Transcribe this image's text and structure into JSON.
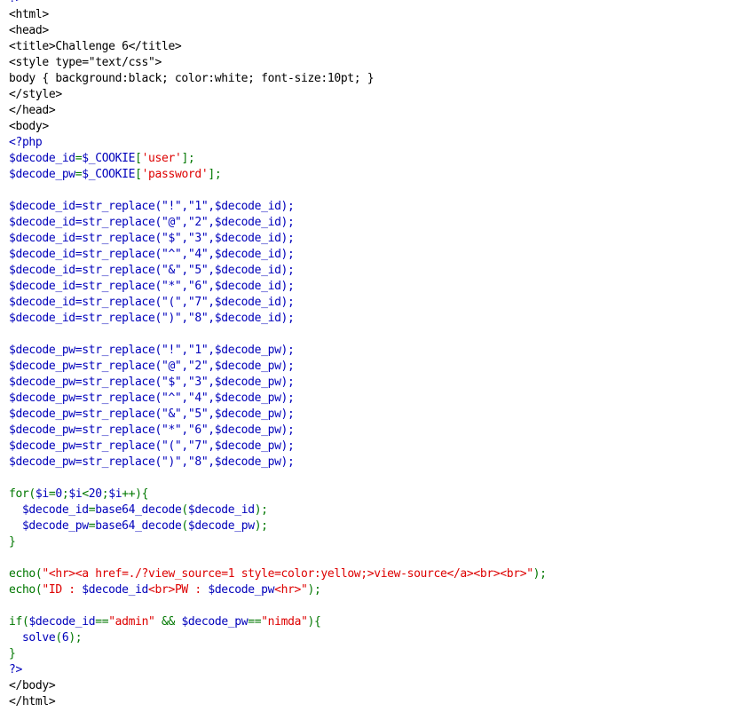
{
  "colors": {
    "html": "#000000",
    "php_default": "#0000BB",
    "php_keyword": "#007700",
    "php_string": "#DD0000",
    "background": "#FFFFFF"
  },
  "source_lines": [
    [
      {
        "t": "?>",
        "c": "php"
      }
    ],
    [
      {
        "t": "<html>",
        "c": "html"
      }
    ],
    [
      {
        "t": "<head>",
        "c": "html"
      }
    ],
    [
      {
        "t": "<title>Challenge 6</title>",
        "c": "html"
      }
    ],
    [
      {
        "t": "<style type=\"text/css\">",
        "c": "html"
      }
    ],
    [
      {
        "t": "body { background:black; color:white; font-size:10pt; }",
        "c": "html"
      }
    ],
    [
      {
        "t": "</style>",
        "c": "html"
      }
    ],
    [
      {
        "t": "</head>",
        "c": "html"
      }
    ],
    [
      {
        "t": "<body>",
        "c": "html"
      }
    ],
    [
      {
        "t": "<?php",
        "c": "php"
      }
    ],
    [
      {
        "t": "$decode_id",
        "c": "php"
      },
      {
        "t": "=",
        "c": "kw"
      },
      {
        "t": "$_COOKIE",
        "c": "php"
      },
      {
        "t": "[",
        "c": "kw"
      },
      {
        "t": "'user'",
        "c": "str"
      },
      {
        "t": "];",
        "c": "kw"
      }
    ],
    [
      {
        "t": "$decode_pw",
        "c": "php"
      },
      {
        "t": "=",
        "c": "kw"
      },
      {
        "t": "$_COOKIE",
        "c": "php"
      },
      {
        "t": "[",
        "c": "kw"
      },
      {
        "t": "'password'",
        "c": "str"
      },
      {
        "t": "];",
        "c": "kw"
      }
    ],
    [
      {
        "t": "",
        "c": "html"
      }
    ],
    [
      {
        "t": "$decode_id=str_replace(\"!\",\"1\",$decode_id);",
        "c": "php"
      }
    ],
    [
      {
        "t": "$decode_id=str_replace(\"@\",\"2\",$decode_id);",
        "c": "php"
      }
    ],
    [
      {
        "t": "$decode_id=str_replace(\"$\",\"3\",$decode_id);",
        "c": "php"
      }
    ],
    [
      {
        "t": "$decode_id=str_replace(\"^\",\"4\",$decode_id);",
        "c": "php"
      }
    ],
    [
      {
        "t": "$decode_id=str_replace(\"&\",\"5\",$decode_id);",
        "c": "php"
      }
    ],
    [
      {
        "t": "$decode_id=str_replace(\"*\",\"6\",$decode_id);",
        "c": "php"
      }
    ],
    [
      {
        "t": "$decode_id=str_replace(\"(\",\"7\",$decode_id);",
        "c": "php"
      }
    ],
    [
      {
        "t": "$decode_id=str_replace(\")\",\"8\",$decode_id);",
        "c": "php"
      }
    ],
    [
      {
        "t": "",
        "c": "html"
      }
    ],
    [
      {
        "t": "$decode_pw=str_replace(\"!\",\"1\",$decode_pw);",
        "c": "php"
      }
    ],
    [
      {
        "t": "$decode_pw=str_replace(\"@\",\"2\",$decode_pw);",
        "c": "php"
      }
    ],
    [
      {
        "t": "$decode_pw=str_replace(\"$\",\"3\",$decode_pw);",
        "c": "php"
      }
    ],
    [
      {
        "t": "$decode_pw=str_replace(\"^\",\"4\",$decode_pw);",
        "c": "php"
      }
    ],
    [
      {
        "t": "$decode_pw=str_replace(\"&\",\"5\",$decode_pw);",
        "c": "php"
      }
    ],
    [
      {
        "t": "$decode_pw=str_replace(\"*\",\"6\",$decode_pw);",
        "c": "php"
      }
    ],
    [
      {
        "t": "$decode_pw=str_replace(\"(\",\"7\",$decode_pw);",
        "c": "php"
      }
    ],
    [
      {
        "t": "$decode_pw=str_replace(\")\",\"8\",$decode_pw);",
        "c": "php"
      }
    ],
    [
      {
        "t": "",
        "c": "html"
      }
    ],
    [
      {
        "t": "for(",
        "c": "kw"
      },
      {
        "t": "$i",
        "c": "php"
      },
      {
        "t": "=",
        "c": "kw"
      },
      {
        "t": "0",
        "c": "php"
      },
      {
        "t": ";",
        "c": "kw"
      },
      {
        "t": "$i",
        "c": "php"
      },
      {
        "t": "<",
        "c": "kw"
      },
      {
        "t": "20",
        "c": "php"
      },
      {
        "t": ";",
        "c": "kw"
      },
      {
        "t": "$i",
        "c": "php"
      },
      {
        "t": "++){",
        "c": "kw"
      }
    ],
    [
      {
        "t": "  $decode_id",
        "c": "php"
      },
      {
        "t": "=",
        "c": "kw"
      },
      {
        "t": "base64_decode",
        "c": "php"
      },
      {
        "t": "(",
        "c": "kw"
      },
      {
        "t": "$decode_id",
        "c": "php"
      },
      {
        "t": ");",
        "c": "kw"
      }
    ],
    [
      {
        "t": "  $decode_pw",
        "c": "php"
      },
      {
        "t": "=",
        "c": "kw"
      },
      {
        "t": "base64_decode",
        "c": "php"
      },
      {
        "t": "(",
        "c": "kw"
      },
      {
        "t": "$decode_pw",
        "c": "php"
      },
      {
        "t": ");",
        "c": "kw"
      }
    ],
    [
      {
        "t": "}",
        "c": "kw"
      }
    ],
    [
      {
        "t": "",
        "c": "html"
      }
    ],
    [
      {
        "t": "echo(",
        "c": "kw"
      },
      {
        "t": "\"<hr><a href=./?view_source=1 style=color:yellow;>view-source</a><br><br>\"",
        "c": "str"
      },
      {
        "t": ");",
        "c": "kw"
      }
    ],
    [
      {
        "t": "echo(",
        "c": "kw"
      },
      {
        "t": "\"ID : ",
        "c": "str"
      },
      {
        "t": "$decode_id",
        "c": "php"
      },
      {
        "t": "<br>PW : ",
        "c": "str"
      },
      {
        "t": "$decode_pw",
        "c": "php"
      },
      {
        "t": "<hr>\"",
        "c": "str"
      },
      {
        "t": ");",
        "c": "kw"
      }
    ],
    [
      {
        "t": "",
        "c": "html"
      }
    ],
    [
      {
        "t": "if(",
        "c": "kw"
      },
      {
        "t": "$decode_id",
        "c": "php"
      },
      {
        "t": "==",
        "c": "kw"
      },
      {
        "t": "\"admin\"",
        "c": "str"
      },
      {
        "t": " && ",
        "c": "kw"
      },
      {
        "t": "$decode_pw",
        "c": "php"
      },
      {
        "t": "==",
        "c": "kw"
      },
      {
        "t": "\"nimda\"",
        "c": "str"
      },
      {
        "t": "){",
        "c": "kw"
      }
    ],
    [
      {
        "t": "  solve",
        "c": "php"
      },
      {
        "t": "(",
        "c": "kw"
      },
      {
        "t": "6",
        "c": "php"
      },
      {
        "t": ");",
        "c": "kw"
      }
    ],
    [
      {
        "t": "}",
        "c": "kw"
      }
    ],
    [
      {
        "t": "?>",
        "c": "php"
      }
    ],
    [
      {
        "t": "</body>",
        "c": "html"
      }
    ],
    [
      {
        "t": "</html>",
        "c": "html"
      }
    ]
  ]
}
